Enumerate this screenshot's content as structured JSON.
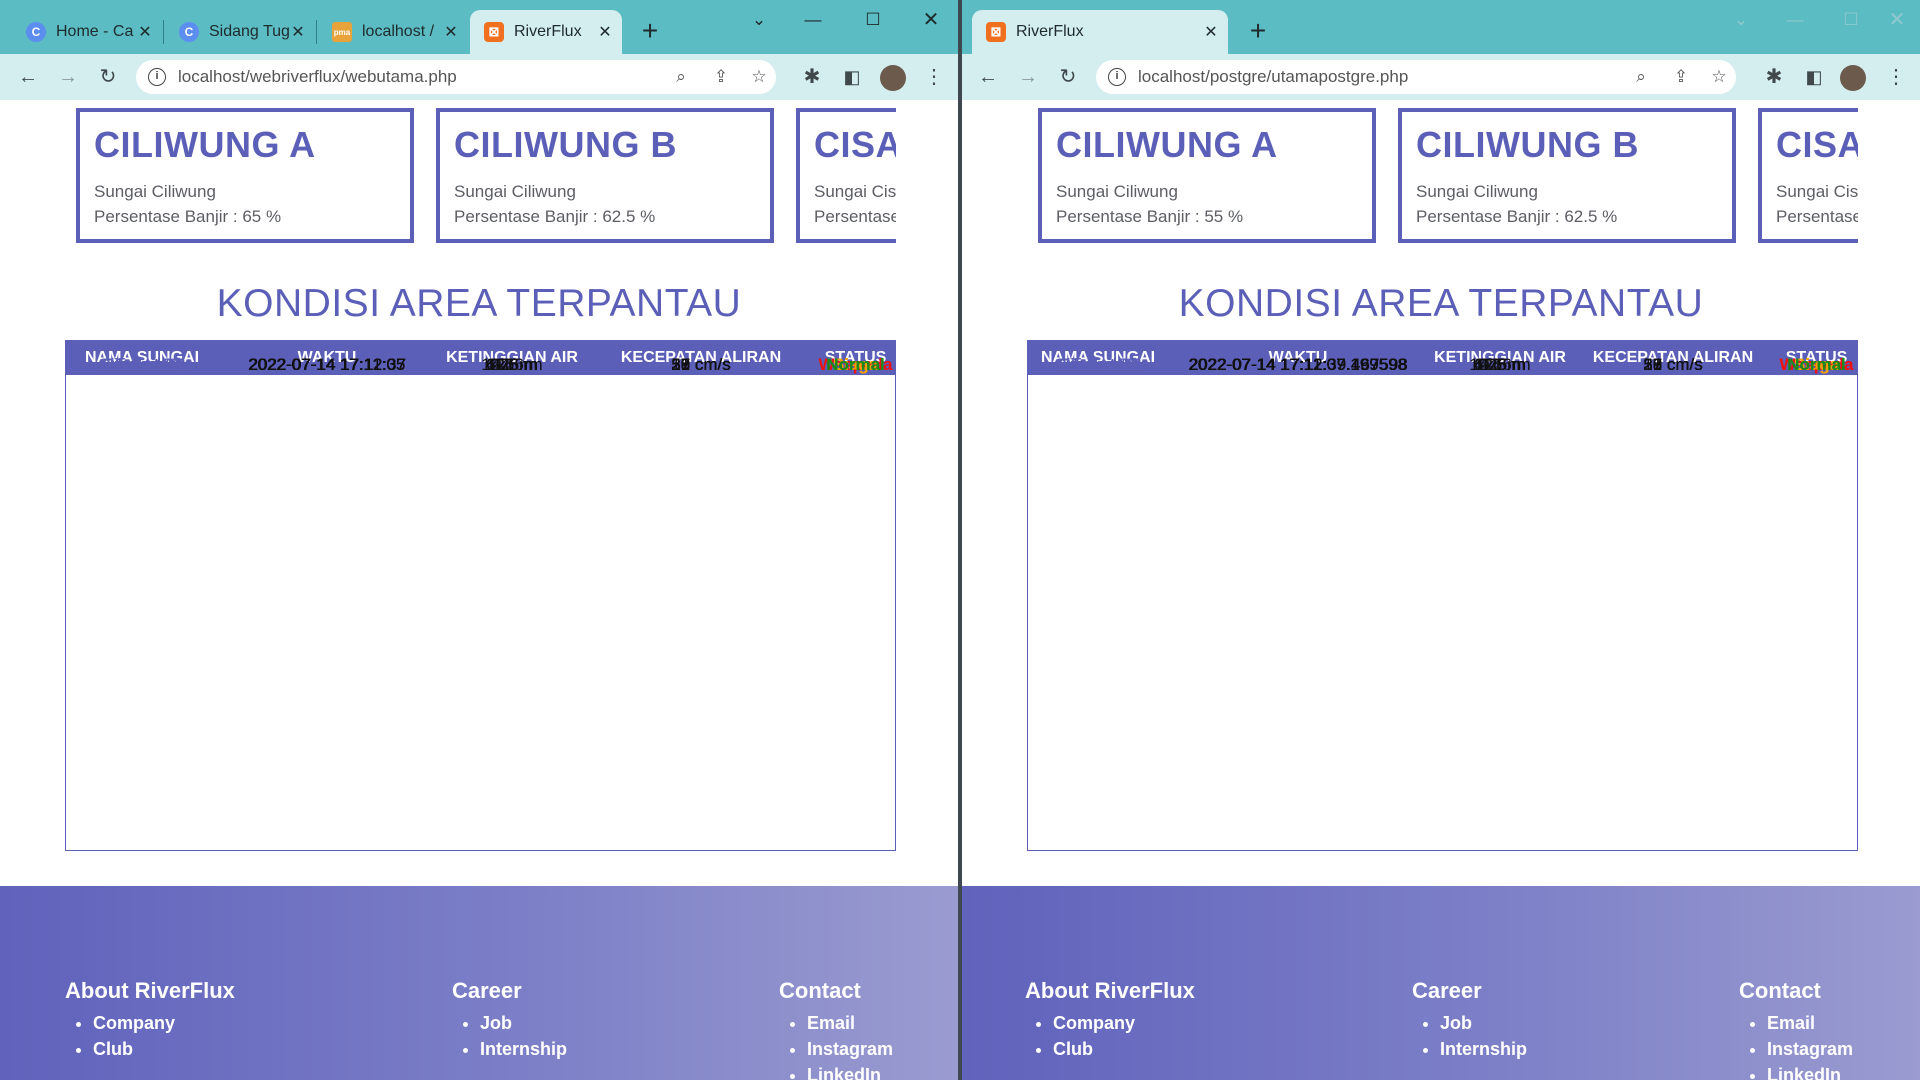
{
  "windows": {
    "left": {
      "tabs": [
        {
          "label": "Home - Ca",
          "favicon": "C"
        },
        {
          "label": "Sidang Tug",
          "favicon": "C"
        },
        {
          "label": "localhost /",
          "favicon": "pma"
        },
        {
          "label": "RiverFlux",
          "favicon": "xampp"
        }
      ],
      "url": "localhost/webriverflux/webutama.php",
      "cards": [
        {
          "name": "CILIWUNG A",
          "river": "Sungai Ciliwung",
          "percent": "Persentase Banjir : 65 %"
        },
        {
          "name": "CILIWUNG B",
          "river": "Sungai Ciliwung",
          "percent": "Persentase Banjir : 62.5 %"
        },
        {
          "name": "CISADANE A",
          "river": "Sungai Cisadane",
          "percent": "Persentase Banjir"
        }
      ],
      "section_title": "KONDISI AREA TERPANTAU",
      "table": {
        "headers": [
          "NAMA SUNGAI",
          "WAKTU",
          "KETINGGIAN AIR",
          "KECEPATAN ALIRAN",
          "STATUS"
        ],
        "rows": [
          {
            "name": "Ciliwung A",
            "time": "2022-07-14 17:12:37",
            "height": "6.1 m",
            "speed": "21 cm/s",
            "status": "Siaga"
          },
          {
            "name": "Ciliwung B",
            "time": "2022-07-14 17:12:37",
            "height": "6.25 m",
            "speed": "59 cm/s",
            "status": "Siaga"
          },
          {
            "name": "Cisadane A",
            "time": "2022-07-14 17:12:37",
            "height": "12.5 m",
            "speed": "27 cm/s",
            "status": "Normal"
          },
          {
            "name": "Cisadane B",
            "time": "2022-07-14 17:12:37",
            "height": "11.6 m",
            "speed": "53 cm/s",
            "status": "Normal"
          },
          {
            "name": "Krukut A",
            "time": "2022-07-14 17:12:37",
            "height": "4.6 m",
            "speed": "18 cm/s",
            "status": "Waspada"
          },
          {
            "name": "Krukut B",
            "time": "2022-07-14 17:12:37",
            "height": "4.75 m",
            "speed": "27 cm/s",
            "status": "Siaga"
          },
          {
            "name": "Ciliwung A",
            "time": "2022-07-14 17:11:05",
            "height": "6.25 m",
            "speed": "20 cm/s",
            "status": "Siaga"
          },
          {
            "name": "Ciliwung B",
            "time": "2022-07-14 17:11:05",
            "height": "6.45 m",
            "speed": "37 cm/s",
            "status": "Siaga"
          },
          {
            "name": "Cisadane A",
            "time": "2022-07-14 17:11:05",
            "height": "12.66 m",
            "speed": "29 cm/s",
            "status": "Normal"
          },
          {
            "name": "Cisadane B",
            "time": "2022-07-14 17:11:05",
            "height": "11.8 m",
            "speed": "33 cm/s",
            "status": "Normal"
          }
        ]
      }
    },
    "right": {
      "tabs": [
        {
          "label": "RiverFlux",
          "favicon": "xampp"
        }
      ],
      "url": "localhost/postgre/utamapostgre.php",
      "cards": [
        {
          "name": "CILIWUNG A",
          "river": "Sungai Ciliwung",
          "percent": "Persentase Banjir : 55 %"
        },
        {
          "name": "CILIWUNG B",
          "river": "Sungai Ciliwung",
          "percent": "Persentase Banjir : 62.5 %"
        },
        {
          "name": "CISADANE A",
          "river": "Sungai Cisadane",
          "percent": "Persentase Banjir"
        }
      ],
      "section_title": "KONDISI AREA TERPANTAU",
      "table": {
        "headers": [
          "NAMA SUNGAI",
          "WAKTU",
          "KETINGGIAN AIR",
          "KECEPATAN ALIRAN",
          "STATUS"
        ],
        "rows": [
          {
            "name": "Ciliwung A",
            "time": "2022-07-14 17:12:39.467598",
            "height": "6.1 m",
            "speed": "21 cm/s",
            "status": "Siaga"
          },
          {
            "name": "Ciliwung B",
            "time": "2022-07-14 17:12:39.467598",
            "height": "6.25 m",
            "speed": "59 cm/s",
            "status": "Siaga"
          },
          {
            "name": "Cisadane A",
            "time": "2022-07-14 17:12:39.467598",
            "height": "12.5 m",
            "speed": "27 cm/s",
            "status": "Normal"
          },
          {
            "name": "Cisadane B",
            "time": "2022-07-14 17:12:39.467598",
            "height": "11.6 m",
            "speed": "53 cm/s",
            "status": "Normal"
          },
          {
            "name": "Krukut A",
            "time": "2022-07-14 17:12:39.467598",
            "height": "4.6 m",
            "speed": "18 cm/s",
            "status": "Waspada"
          },
          {
            "name": "Krukut B",
            "time": "2022-07-14 17:12:39.467598",
            "height": "4.75 m",
            "speed": "27 cm/s",
            "status": "Waspada"
          },
          {
            "name": "Ciliwung A",
            "time": "2022-07-14 17:11:07.199598",
            "height": "6.25 m",
            "speed": "20 cm/s",
            "status": "Siaga"
          },
          {
            "name": "Ciliwung B",
            "time": "2022-07-14 17:11:07.199598",
            "height": "6.45 m",
            "speed": "37 cm/s",
            "status": "Siaga"
          },
          {
            "name": "Cisadane A",
            "time": "2022-07-14 17:11:07.199598",
            "height": "12.66 m",
            "speed": "29 cm/s",
            "status": "Normal"
          },
          {
            "name": "Cisadane B",
            "time": "2022-07-14 17:11:07.199598",
            "height": "11.8 m",
            "speed": "33 cm/s",
            "status": "Normal"
          }
        ]
      }
    }
  },
  "footer": {
    "columns": [
      {
        "title": "About RiverFlux",
        "items": [
          "Company",
          "Club"
        ]
      },
      {
        "title": "Career",
        "items": [
          "Job",
          "Internship"
        ]
      },
      {
        "title": "Contact",
        "items": [
          "Email",
          "Instagram",
          "LinkedIn"
        ]
      }
    ]
  },
  "status_colors": {
    "Siaga": "#f5a000",
    "Normal": "#1a8a1a",
    "Waspada": "#ee1111"
  },
  "accent_color": "#5c5fb8",
  "icons": {
    "back": "arrow-left-icon",
    "forward": "arrow-right-icon",
    "reload": "reload-icon",
    "info": "info-icon",
    "zoom": "zoom-icon",
    "share": "share-icon",
    "bookmark": "star-icon",
    "extensions": "puzzle-icon",
    "sidepanel": "side-panel-icon",
    "profile": "avatar",
    "menu": "kebab-menu-icon"
  }
}
